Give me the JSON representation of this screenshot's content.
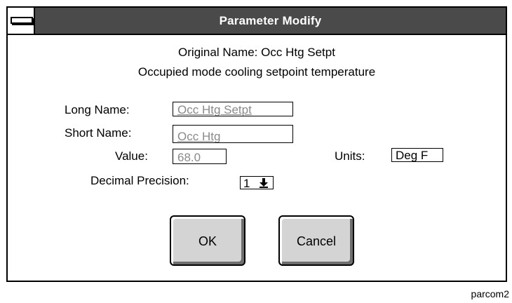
{
  "window": {
    "title": "Parameter Modify"
  },
  "header": {
    "original_name": "Original Name: Occ Htg Setpt",
    "description": "Occupied mode cooling setpoint temperature"
  },
  "fields": {
    "long_name_label": "Long Name:",
    "long_name_value": "Occ Htg Setpt",
    "short_name_label": "Short Name:",
    "short_name_value": "Occ Htg",
    "value_label": "Value:",
    "value_value": "68.0",
    "units_label": "Units:",
    "units_value": "Deg F",
    "decimal_precision_label": "Decimal Precision:",
    "decimal_precision_value": "1"
  },
  "buttons": {
    "ok_label": "OK",
    "cancel_label": "Cancel"
  },
  "caption": "parcom2",
  "icons": {
    "system_menu": "system-menu-icon",
    "dropdown_arrow": "down-arrow-icon"
  },
  "colors": {
    "titlebar": "#4a4a4a",
    "button_face": "#d4d4d4",
    "field_text": "#8a8a8a"
  }
}
